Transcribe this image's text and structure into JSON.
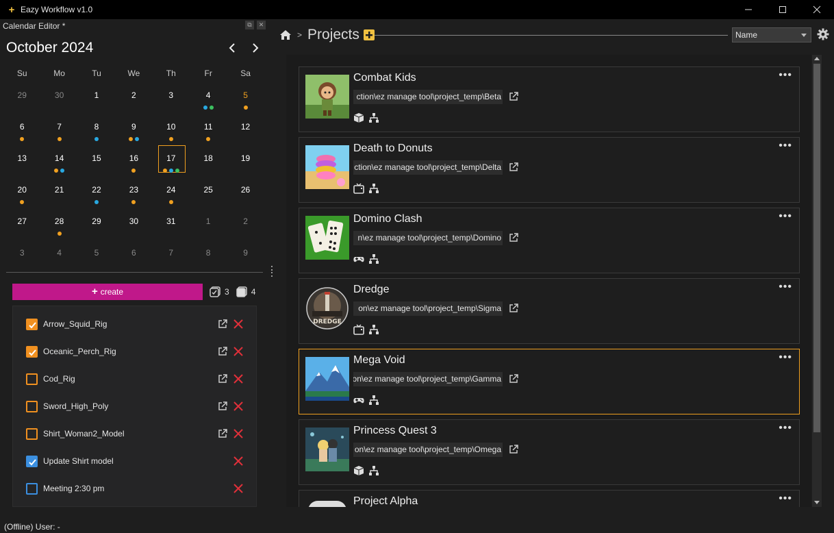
{
  "window": {
    "title": "Eazy Workflow v1.0",
    "minimize": "—",
    "maximize": "☐",
    "close": "✕"
  },
  "calendar_panel": {
    "title": "Calendar Editor *",
    "month_title": "October 2024",
    "dow": [
      "Su",
      "Mo",
      "Tu",
      "We",
      "Th",
      "Fr",
      "Sa"
    ],
    "weeks": [
      [
        {
          "d": "29",
          "out": true
        },
        {
          "d": "30",
          "out": true
        },
        {
          "d": "1"
        },
        {
          "d": "2"
        },
        {
          "d": "3"
        },
        {
          "d": "4",
          "dots": [
            "#29a8e0",
            "#3cc060"
          ]
        },
        {
          "d": "5",
          "sat": true,
          "dots": [
            "#f0a020"
          ]
        }
      ],
      [
        {
          "d": "6",
          "dots": [
            "#f0a020"
          ]
        },
        {
          "d": "7",
          "dots": [
            "#f0a020"
          ]
        },
        {
          "d": "8",
          "dots": [
            "#29a8e0"
          ]
        },
        {
          "d": "9",
          "dots": [
            "#f0a020",
            "#29a8e0"
          ]
        },
        {
          "d": "10",
          "dots": [
            "#f0a020"
          ]
        },
        {
          "d": "11",
          "dots": [
            "#f0a020"
          ]
        },
        {
          "d": "12"
        }
      ],
      [
        {
          "d": "13"
        },
        {
          "d": "14",
          "dots": [
            "#f0a020",
            "#29a8e0"
          ]
        },
        {
          "d": "15"
        },
        {
          "d": "16",
          "dots": [
            "#f0a020"
          ]
        },
        {
          "d": "17",
          "today": true,
          "dots": [
            "#f0a020",
            "#29a8e0",
            "#3cc060"
          ]
        },
        {
          "d": "18"
        },
        {
          "d": "19"
        }
      ],
      [
        {
          "d": "20",
          "dots": [
            "#f0a020"
          ]
        },
        {
          "d": "21"
        },
        {
          "d": "22",
          "dots": [
            "#29a8e0"
          ]
        },
        {
          "d": "23",
          "dots": [
            "#f0a020"
          ]
        },
        {
          "d": "24",
          "dots": [
            "#f0a020"
          ]
        },
        {
          "d": "25"
        },
        {
          "d": "26"
        }
      ],
      [
        {
          "d": "27"
        },
        {
          "d": "28",
          "dots": [
            "#f0a020"
          ]
        },
        {
          "d": "29"
        },
        {
          "d": "30"
        },
        {
          "d": "31"
        },
        {
          "d": "1",
          "out": true
        },
        {
          "d": "2",
          "out": true
        }
      ],
      [
        {
          "d": "3",
          "out": true
        },
        {
          "d": "4",
          "out": true
        },
        {
          "d": "5",
          "out": true
        },
        {
          "d": "6",
          "out": true
        },
        {
          "d": "7",
          "out": true
        },
        {
          "d": "8",
          "out": true
        },
        {
          "d": "9",
          "out": true
        }
      ]
    ],
    "create_label": "create",
    "count_tasks": "3",
    "count_total": "4",
    "todos": [
      {
        "label": "Arrow_Squid_Rig",
        "checked": true,
        "color": "orange",
        "linked": true
      },
      {
        "label": "Oceanic_Perch_Rig",
        "checked": true,
        "color": "orange",
        "linked": true
      },
      {
        "label": "Cod_Rig",
        "checked": false,
        "color": "orange",
        "linked": true
      },
      {
        "label": "Sword_High_Poly",
        "checked": false,
        "color": "orange",
        "linked": true
      },
      {
        "label": "Shirt_Woman2_Model",
        "checked": false,
        "color": "orange",
        "linked": true
      },
      {
        "label": "Update Shirt model",
        "checked": true,
        "color": "blue",
        "linked": false
      },
      {
        "label": "Meeting 2:30 pm",
        "checked": false,
        "color": "blue",
        "linked": false
      }
    ]
  },
  "projects_view": {
    "breadcrumb_sep": ">",
    "title": "Projects",
    "sort_value": "Name",
    "projects": [
      {
        "title": "Combat Kids",
        "path": "ction\\ez manage tool\\project_temp\\Beta",
        "type_icon": "package-icon",
        "thumb": "hero"
      },
      {
        "title": "Death to Donuts",
        "path": "ction\\ez manage tool\\project_temp\\Delta",
        "type_icon": "tv-icon",
        "thumb": "donut"
      },
      {
        "title": "Domino Clash",
        "path": "n\\ez manage tool\\project_temp\\Domino",
        "type_icon": "gamepad-icon",
        "thumb": "domino"
      },
      {
        "title": "Dredge",
        "path": "on\\ez manage tool\\project_temp\\Sigma",
        "type_icon": "tv-icon",
        "thumb": "dredge",
        "thumb_text": "DREDGE"
      },
      {
        "title": "Mega Void",
        "path": "on\\ez manage tool\\project_temp\\Gamma",
        "type_icon": "gamepad-icon",
        "thumb": "mountain",
        "selected": true
      },
      {
        "title": "Princess Quest 3",
        "path": "on\\ez manage tool\\project_temp\\Omega",
        "type_icon": "package-icon",
        "thumb": "princess"
      },
      {
        "title": "Project Alpha",
        "path": "",
        "type_icon": "",
        "thumb": "alpha"
      }
    ],
    "more_label": "•••"
  },
  "status": {
    "text": "(Offline) User: -"
  },
  "colors": {
    "accent": "#f0a020",
    "create": "#c0188a",
    "blue": "#29a8e0",
    "green": "#3cc060",
    "delete": "#e0303a"
  }
}
